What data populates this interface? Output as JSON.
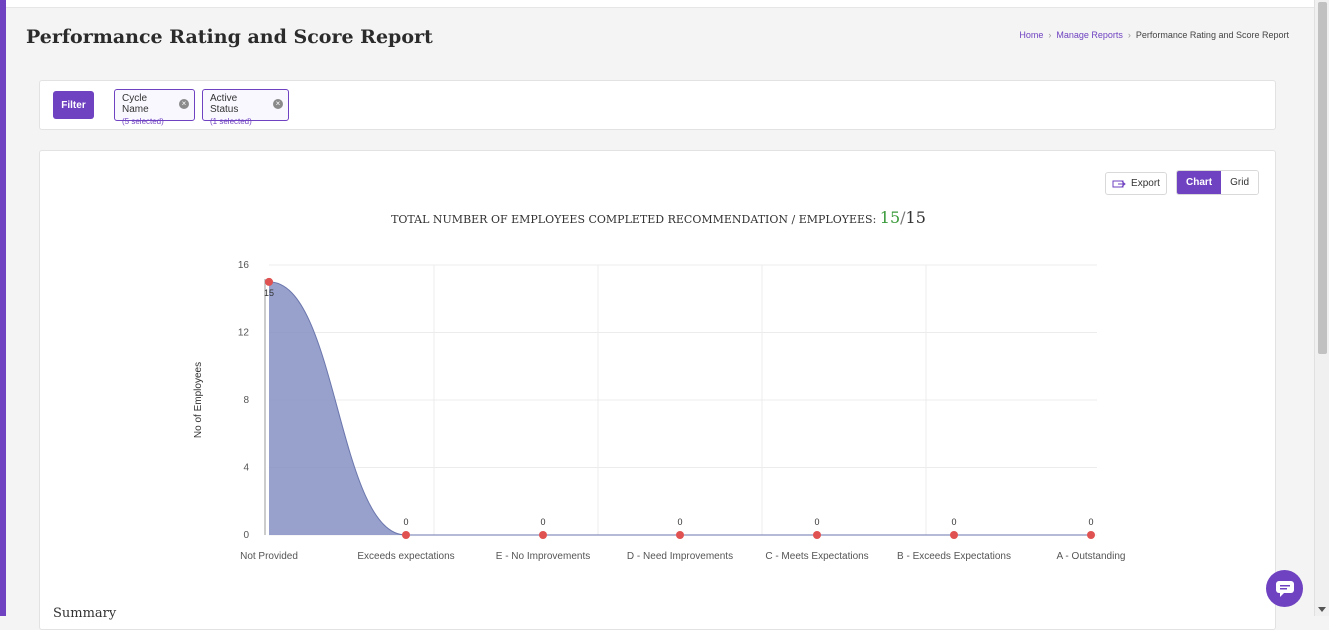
{
  "page": {
    "title": "Performance Rating and Score Report"
  },
  "breadcrumb": {
    "home": "Home",
    "manage_reports": "Manage Reports",
    "current": "Performance Rating and Score Report"
  },
  "filter": {
    "button_label": "Filter",
    "chips": [
      {
        "title": "Cycle Name",
        "sub": "(5 selected)"
      },
      {
        "title": "Active Status",
        "sub": "(1 selected)"
      }
    ]
  },
  "toolbar": {
    "export_label": "Export",
    "chart_label": "Chart",
    "grid_label": "Grid",
    "active_view": "chart"
  },
  "heading": {
    "text": "TOTAL NUMBER OF EMPLOYEES COMPLETED RECOMMENDATION / EMPLOYEES:",
    "completed": "15",
    "separator": "/",
    "total": "15"
  },
  "chart_data": {
    "type": "area",
    "categories": [
      "Not Provided",
      "Exceeds expectations",
      "E - No Improvements",
      "D - Need Improvements",
      "C - Meets Expectations",
      "B - Exceeds Expectations",
      "A - Outstanding"
    ],
    "series": [
      {
        "values": [
          15,
          0,
          0,
          0,
          0,
          0,
          0
        ]
      }
    ],
    "ylabel": "No of Employees",
    "xlabel": "",
    "ylim": [
      0,
      16
    ],
    "yticks": [
      0,
      4,
      8,
      12,
      16
    ],
    "data_labels": true,
    "grid": true,
    "colors": {
      "fill": "#8591c2",
      "line": "#6b76ad",
      "marker": "#e05252"
    }
  },
  "summary": {
    "title": "Summary"
  },
  "colors": {
    "accent": "#6f42c1",
    "completed": "#3a9a3a"
  }
}
